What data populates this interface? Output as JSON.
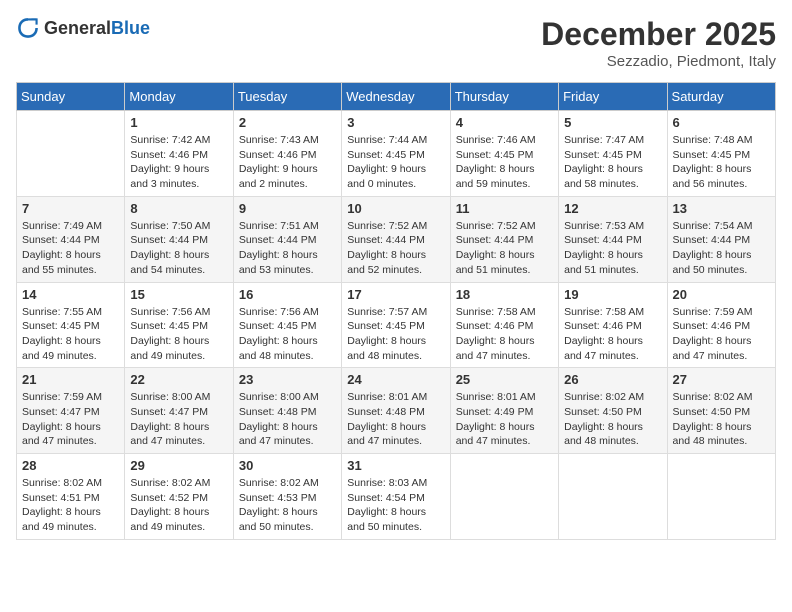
{
  "header": {
    "logo_general": "General",
    "logo_blue": "Blue",
    "month": "December 2025",
    "location": "Sezzadio, Piedmont, Italy"
  },
  "days_of_week": [
    "Sunday",
    "Monday",
    "Tuesday",
    "Wednesday",
    "Thursday",
    "Friday",
    "Saturday"
  ],
  "weeks": [
    [
      {
        "day": "",
        "detail": ""
      },
      {
        "day": "1",
        "detail": "Sunrise: 7:42 AM\nSunset: 4:46 PM\nDaylight: 9 hours\nand 3 minutes."
      },
      {
        "day": "2",
        "detail": "Sunrise: 7:43 AM\nSunset: 4:46 PM\nDaylight: 9 hours\nand 2 minutes."
      },
      {
        "day": "3",
        "detail": "Sunrise: 7:44 AM\nSunset: 4:45 PM\nDaylight: 9 hours\nand 0 minutes."
      },
      {
        "day": "4",
        "detail": "Sunrise: 7:46 AM\nSunset: 4:45 PM\nDaylight: 8 hours\nand 59 minutes."
      },
      {
        "day": "5",
        "detail": "Sunrise: 7:47 AM\nSunset: 4:45 PM\nDaylight: 8 hours\nand 58 minutes."
      },
      {
        "day": "6",
        "detail": "Sunrise: 7:48 AM\nSunset: 4:45 PM\nDaylight: 8 hours\nand 56 minutes."
      }
    ],
    [
      {
        "day": "7",
        "detail": "Sunrise: 7:49 AM\nSunset: 4:44 PM\nDaylight: 8 hours\nand 55 minutes."
      },
      {
        "day": "8",
        "detail": "Sunrise: 7:50 AM\nSunset: 4:44 PM\nDaylight: 8 hours\nand 54 minutes."
      },
      {
        "day": "9",
        "detail": "Sunrise: 7:51 AM\nSunset: 4:44 PM\nDaylight: 8 hours\nand 53 minutes."
      },
      {
        "day": "10",
        "detail": "Sunrise: 7:52 AM\nSunset: 4:44 PM\nDaylight: 8 hours\nand 52 minutes."
      },
      {
        "day": "11",
        "detail": "Sunrise: 7:52 AM\nSunset: 4:44 PM\nDaylight: 8 hours\nand 51 minutes."
      },
      {
        "day": "12",
        "detail": "Sunrise: 7:53 AM\nSunset: 4:44 PM\nDaylight: 8 hours\nand 51 minutes."
      },
      {
        "day": "13",
        "detail": "Sunrise: 7:54 AM\nSunset: 4:44 PM\nDaylight: 8 hours\nand 50 minutes."
      }
    ],
    [
      {
        "day": "14",
        "detail": "Sunrise: 7:55 AM\nSunset: 4:45 PM\nDaylight: 8 hours\nand 49 minutes."
      },
      {
        "day": "15",
        "detail": "Sunrise: 7:56 AM\nSunset: 4:45 PM\nDaylight: 8 hours\nand 49 minutes."
      },
      {
        "day": "16",
        "detail": "Sunrise: 7:56 AM\nSunset: 4:45 PM\nDaylight: 8 hours\nand 48 minutes."
      },
      {
        "day": "17",
        "detail": "Sunrise: 7:57 AM\nSunset: 4:45 PM\nDaylight: 8 hours\nand 48 minutes."
      },
      {
        "day": "18",
        "detail": "Sunrise: 7:58 AM\nSunset: 4:46 PM\nDaylight: 8 hours\nand 47 minutes."
      },
      {
        "day": "19",
        "detail": "Sunrise: 7:58 AM\nSunset: 4:46 PM\nDaylight: 8 hours\nand 47 minutes."
      },
      {
        "day": "20",
        "detail": "Sunrise: 7:59 AM\nSunset: 4:46 PM\nDaylight: 8 hours\nand 47 minutes."
      }
    ],
    [
      {
        "day": "21",
        "detail": "Sunrise: 7:59 AM\nSunset: 4:47 PM\nDaylight: 8 hours\nand 47 minutes."
      },
      {
        "day": "22",
        "detail": "Sunrise: 8:00 AM\nSunset: 4:47 PM\nDaylight: 8 hours\nand 47 minutes."
      },
      {
        "day": "23",
        "detail": "Sunrise: 8:00 AM\nSunset: 4:48 PM\nDaylight: 8 hours\nand 47 minutes."
      },
      {
        "day": "24",
        "detail": "Sunrise: 8:01 AM\nSunset: 4:48 PM\nDaylight: 8 hours\nand 47 minutes."
      },
      {
        "day": "25",
        "detail": "Sunrise: 8:01 AM\nSunset: 4:49 PM\nDaylight: 8 hours\nand 47 minutes."
      },
      {
        "day": "26",
        "detail": "Sunrise: 8:02 AM\nSunset: 4:50 PM\nDaylight: 8 hours\nand 48 minutes."
      },
      {
        "day": "27",
        "detail": "Sunrise: 8:02 AM\nSunset: 4:50 PM\nDaylight: 8 hours\nand 48 minutes."
      }
    ],
    [
      {
        "day": "28",
        "detail": "Sunrise: 8:02 AM\nSunset: 4:51 PM\nDaylight: 8 hours\nand 49 minutes."
      },
      {
        "day": "29",
        "detail": "Sunrise: 8:02 AM\nSunset: 4:52 PM\nDaylight: 8 hours\nand 49 minutes."
      },
      {
        "day": "30",
        "detail": "Sunrise: 8:02 AM\nSunset: 4:53 PM\nDaylight: 8 hours\nand 50 minutes."
      },
      {
        "day": "31",
        "detail": "Sunrise: 8:03 AM\nSunset: 4:54 PM\nDaylight: 8 hours\nand 50 minutes."
      },
      {
        "day": "",
        "detail": ""
      },
      {
        "day": "",
        "detail": ""
      },
      {
        "day": "",
        "detail": ""
      }
    ]
  ]
}
